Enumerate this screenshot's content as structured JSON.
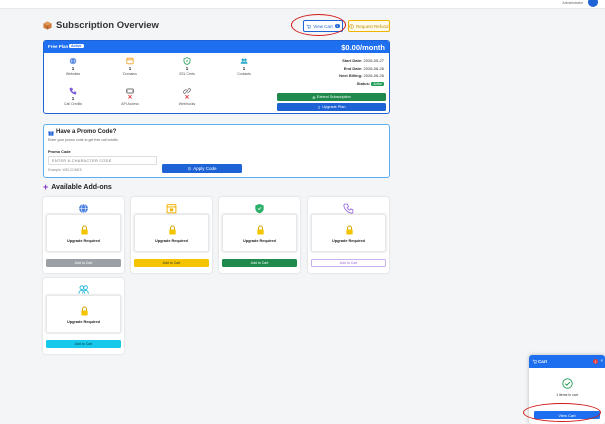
{
  "topbar": {
    "admin_name": "Administrator"
  },
  "header": {
    "title": "Subscription Overview",
    "view_cart_label": "View Cart",
    "cart_count": "1",
    "refund_label": "Request Refund"
  },
  "plan": {
    "name": "Free Plan",
    "active_badge": "Active",
    "price": "$0.00/month",
    "features": [
      {
        "icon": "globe-icon",
        "value": "1",
        "label": "Websites"
      },
      {
        "icon": "domain-icon",
        "value": "1",
        "label": "Domains"
      },
      {
        "icon": "shield-icon",
        "value": "1",
        "label": "SSL Certs"
      },
      {
        "icon": "contacts-icon",
        "value": "1",
        "label": "Contacts"
      },
      {
        "icon": "phone-icon",
        "value": "1",
        "label": "Call Credits"
      },
      {
        "icon": "api-icon",
        "value": "",
        "label": "API Access"
      },
      {
        "icon": "link-icon",
        "value": "",
        "label": "Webhooks"
      }
    ],
    "start_label": "Start Date:",
    "start_value": "2026-05-27",
    "end_label": "End Date:",
    "end_value": "2026-06-26",
    "billing_label": "Next Billing:",
    "billing_value": "2026-06-26",
    "status_label": "Status:",
    "status_value": "Active",
    "extend_label": "Extend Subscription",
    "upgrade_label": "Upgrade Plan"
  },
  "promo": {
    "title": "Have a Promo Code?",
    "subtitle": "Enter your promo code to get free call credits",
    "field_label": "Promo Code",
    "placeholder": "ENTER 6-CHARACTER CODE",
    "example": "Example: WELCOME5",
    "apply_label": "Apply Code"
  },
  "addons": {
    "title": "Available Add-ons",
    "items": [
      {
        "icon": "globe-icon",
        "status": "Upgrade Required",
        "button": "Add to Cart",
        "color": "#9aa0a6"
      },
      {
        "icon": "calendar-icon",
        "status": "Upgrade Required",
        "button": "Add to Cart",
        "color": "#f5c400"
      },
      {
        "icon": "shield-icon",
        "status": "Upgrade Required",
        "button": "Add to Cart",
        "color": "#1f8a4c"
      },
      {
        "icon": "phone-icon",
        "status": "Upgrade Required",
        "button": "Add to Cart",
        "color": "#ffffff"
      },
      {
        "icon": "users-icon",
        "status": "Upgrade Required",
        "button": "Add to Cart",
        "color": "#16c9ea"
      }
    ]
  },
  "cart_popup": {
    "title": "Cart",
    "badge": "1",
    "close": "×",
    "items_text": "1 items in cart",
    "view_cart_label": "View Cart"
  },
  "colors": {
    "primary": "#1e63d6",
    "success": "#1f8a4c",
    "danger": "#e03b3b",
    "warning": "#f0b400"
  }
}
